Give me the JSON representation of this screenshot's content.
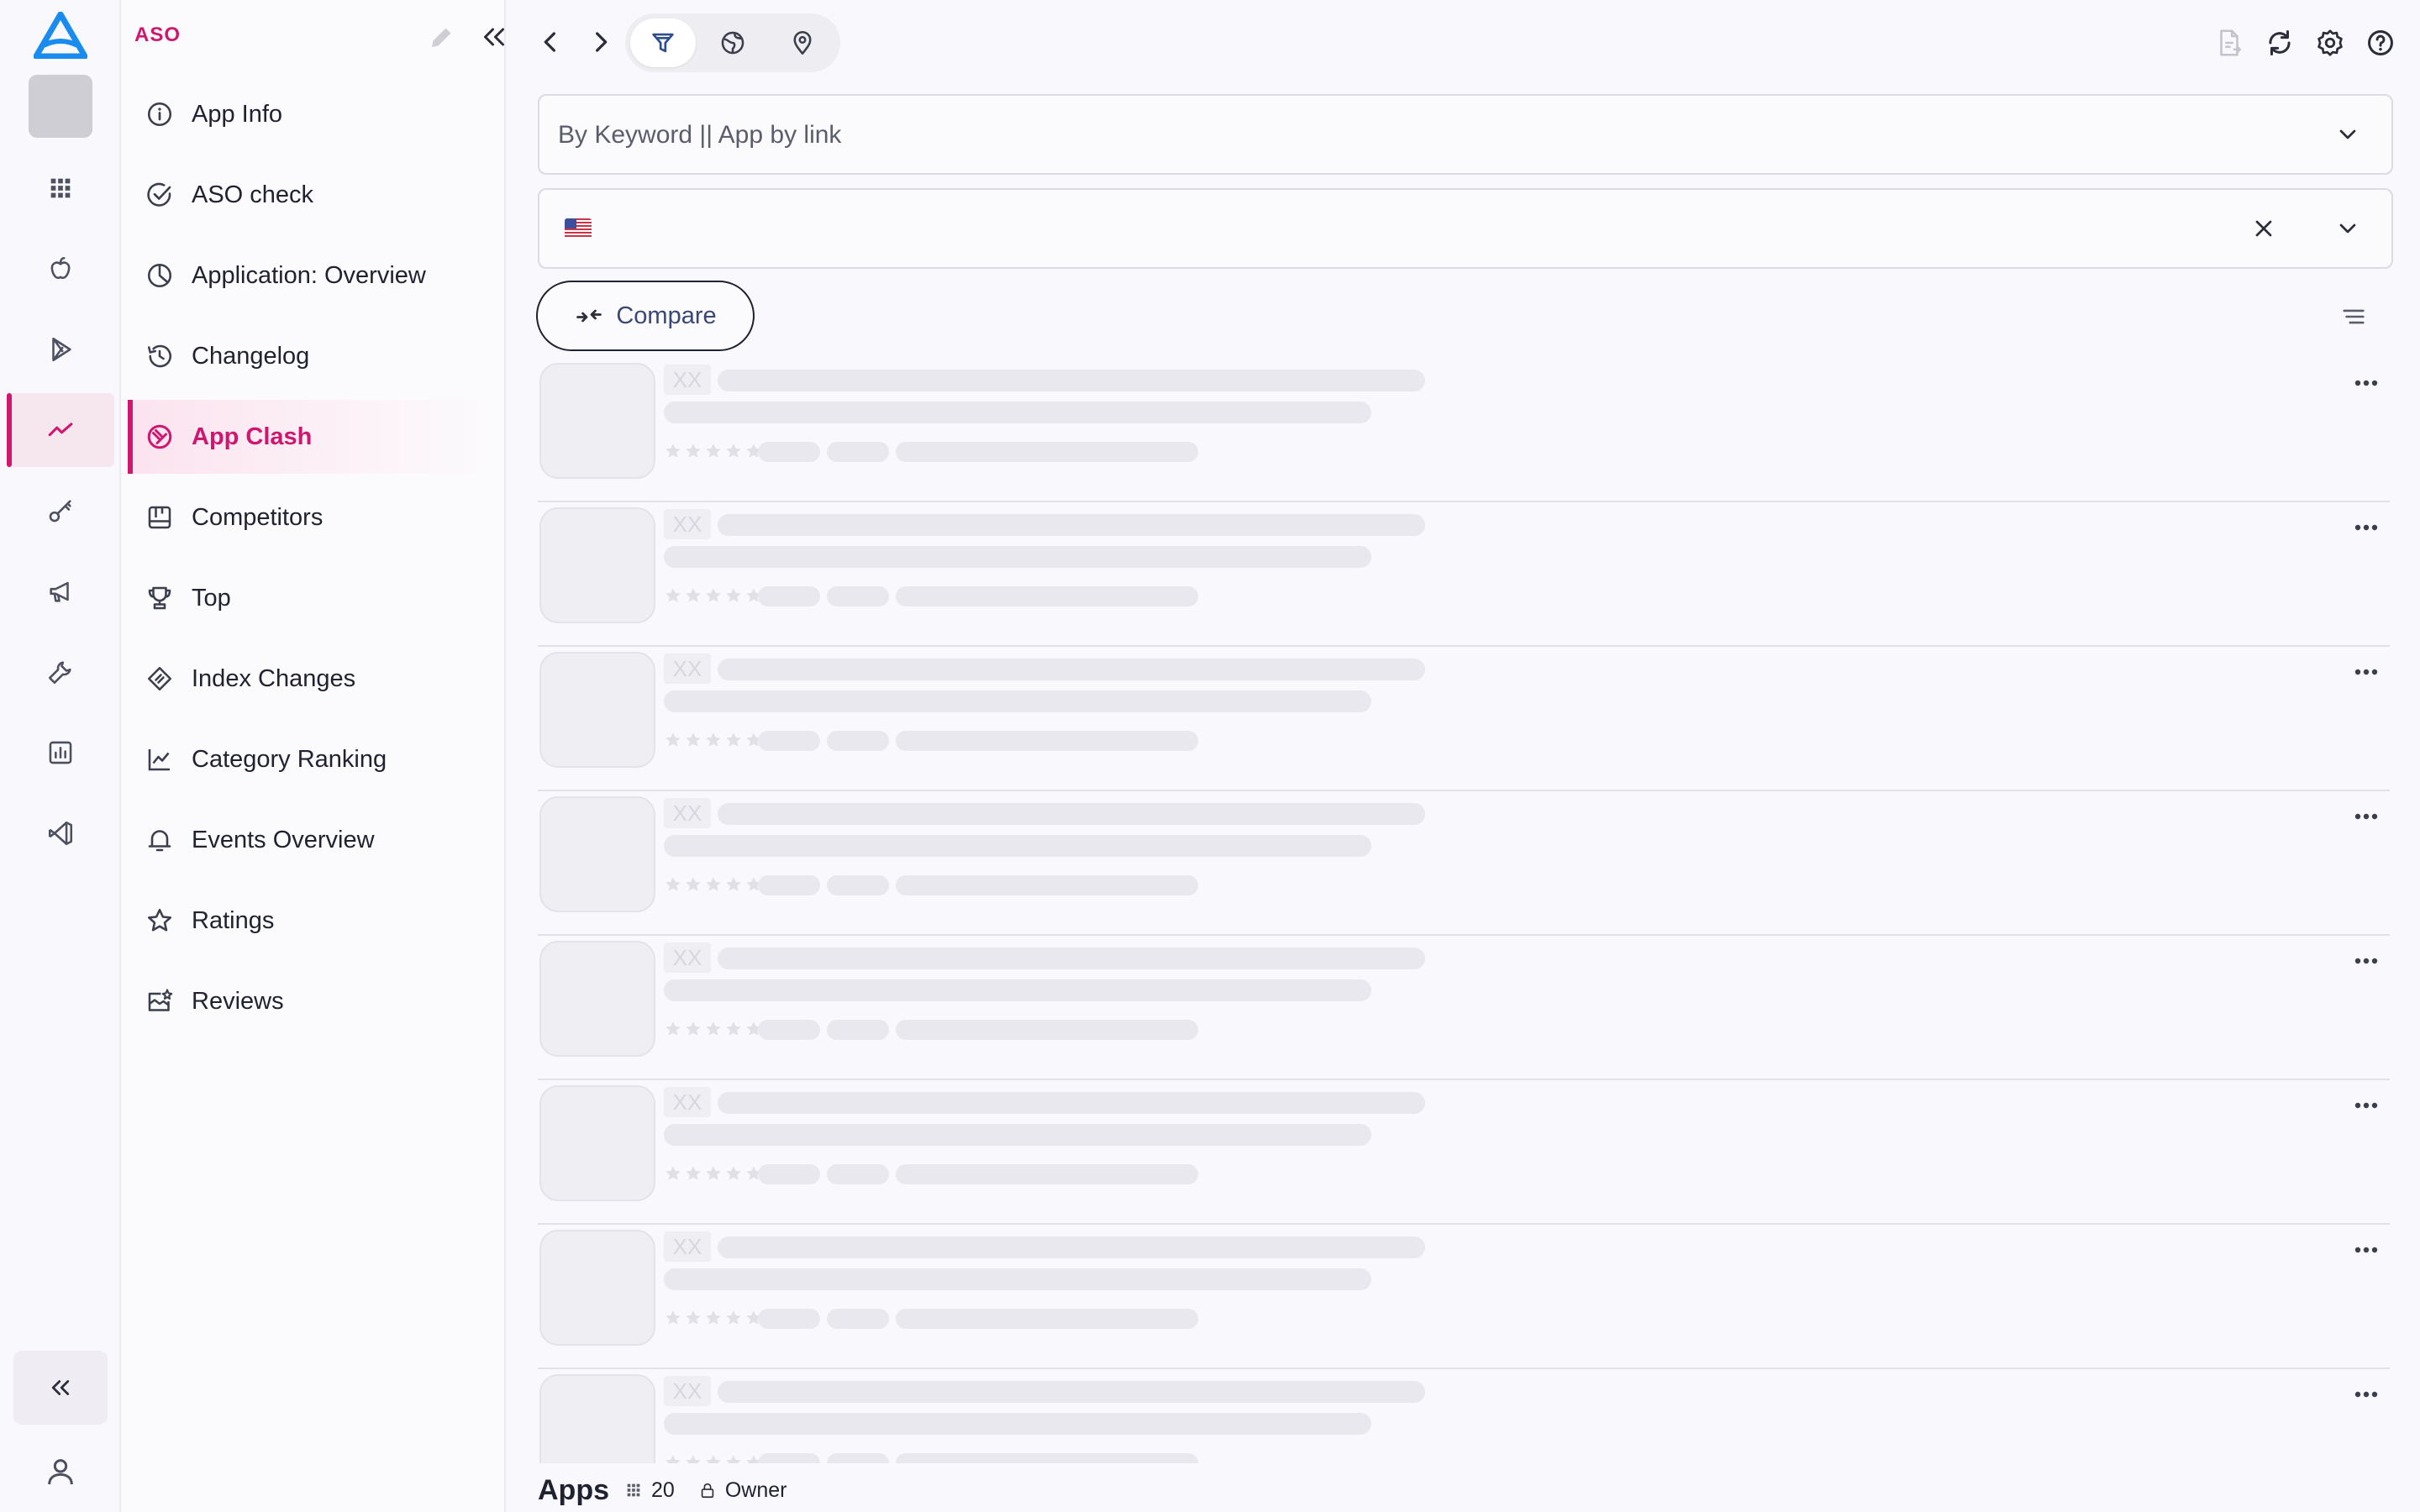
{
  "theme": {
    "accent": "#d0176f",
    "logo": "#1a8cf0",
    "text": "#1f2230"
  },
  "rail": {
    "logo_icon": "brand-logo-icon",
    "items": [
      {
        "icon": "grid-icon"
      },
      {
        "icon": "apple-icon"
      },
      {
        "icon": "google-play-icon"
      },
      {
        "icon": "trend-icon",
        "active": true
      },
      {
        "icon": "key-icon"
      },
      {
        "icon": "megaphone-icon"
      },
      {
        "icon": "wrench-icon"
      },
      {
        "icon": "bar-chart-icon"
      },
      {
        "icon": "vscode-icon"
      }
    ],
    "collapse_icon": "double-chevron-left-icon",
    "user_icon": "user-icon"
  },
  "sidebar": {
    "title": "ASO",
    "items": [
      {
        "label": "App Info",
        "icon": "info-icon"
      },
      {
        "label": "ASO check",
        "icon": "check-circle-icon"
      },
      {
        "label": "Application: Overview",
        "icon": "pie-chart-icon"
      },
      {
        "label": "Changelog",
        "icon": "history-icon"
      },
      {
        "label": "App Clash",
        "icon": "clash-icon",
        "active": true
      },
      {
        "label": "Competitors",
        "icon": "competitors-icon"
      },
      {
        "label": "Top",
        "icon": "trophy-icon"
      },
      {
        "label": "Index Changes",
        "icon": "index-changes-icon"
      },
      {
        "label": "Category Ranking",
        "icon": "line-chart-icon"
      },
      {
        "label": "Events Overview",
        "icon": "bell-icon"
      },
      {
        "label": "Ratings",
        "icon": "star-icon"
      },
      {
        "label": "Reviews",
        "icon": "reviews-icon"
      }
    ]
  },
  "toolbar": {
    "segments": [
      "filter-icon",
      "globe-icon",
      "location-pin-icon"
    ],
    "active_segment": 0,
    "right_icons": [
      "export-file-icon",
      "refresh-icon",
      "settings-icon",
      "help-icon"
    ]
  },
  "search": {
    "placeholder": "By Keyword || App by link"
  },
  "country": {
    "flag": "US"
  },
  "compare": {
    "label": "Compare"
  },
  "list": {
    "rank_placeholder": "XX",
    "skeleton_rows": 8
  },
  "footer": {
    "title": "Apps",
    "count": "20",
    "owner": "Owner"
  }
}
